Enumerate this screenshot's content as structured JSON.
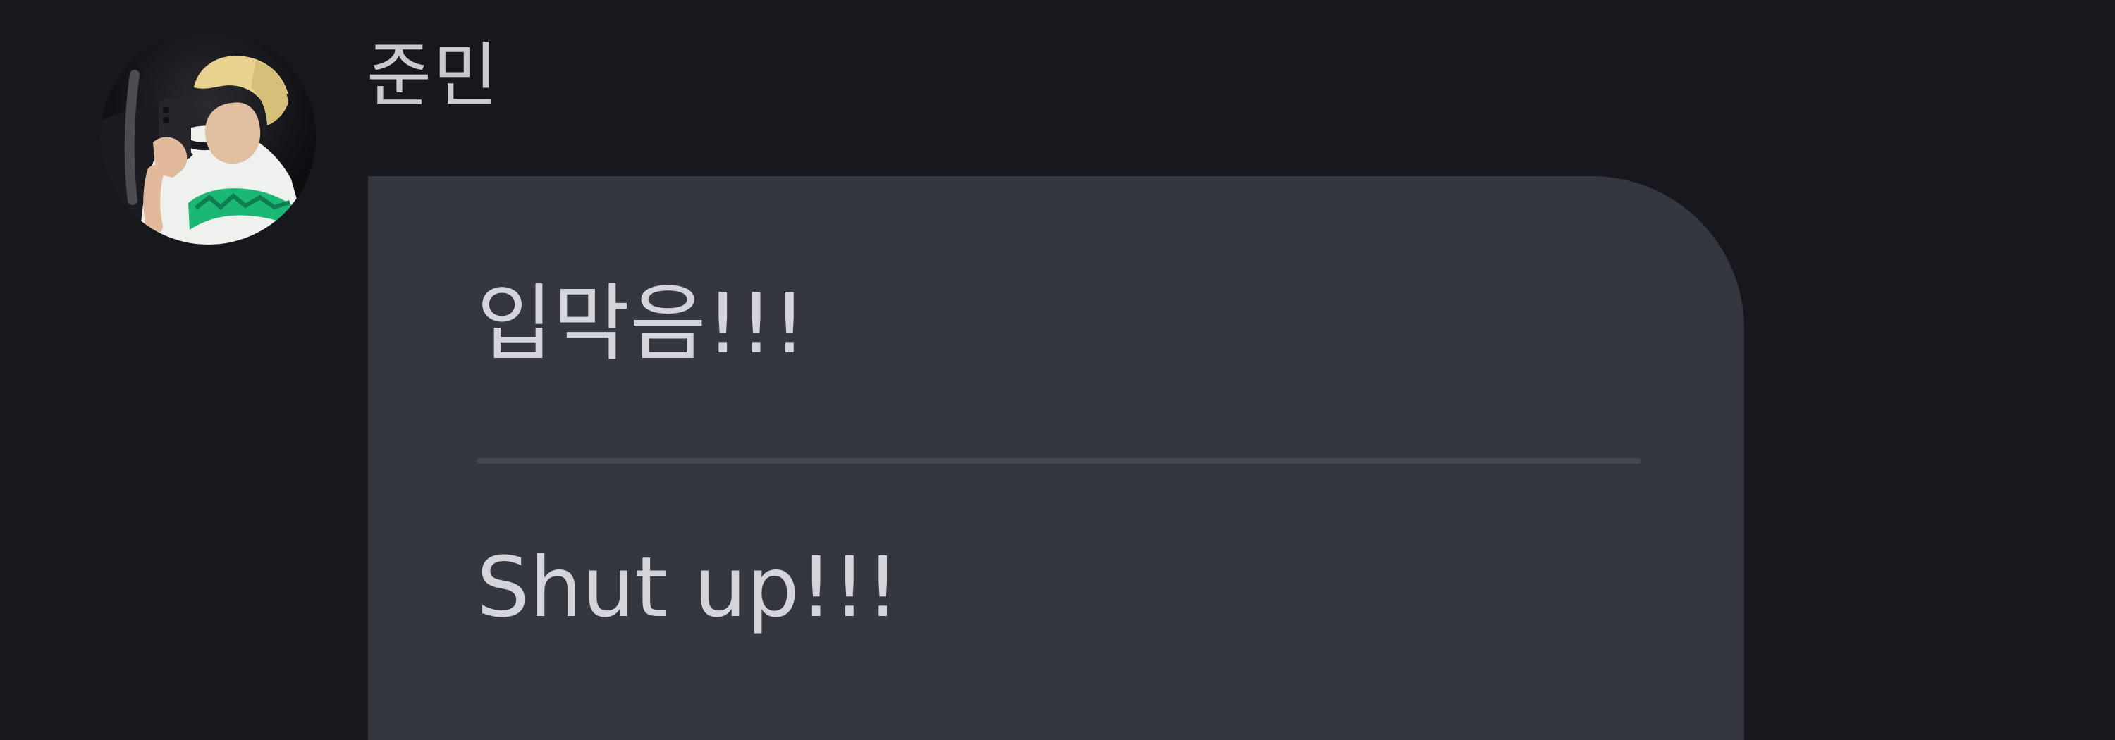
{
  "message": {
    "sender_name": "준민",
    "original_text": "입막음!!!",
    "translated_text": "Shut up!!!"
  },
  "icons": {
    "avatar": "profile-photo"
  },
  "colors": {
    "background": "#17181d",
    "bubble": "#353740",
    "text": "#d4d4db",
    "divider": "#444650"
  }
}
